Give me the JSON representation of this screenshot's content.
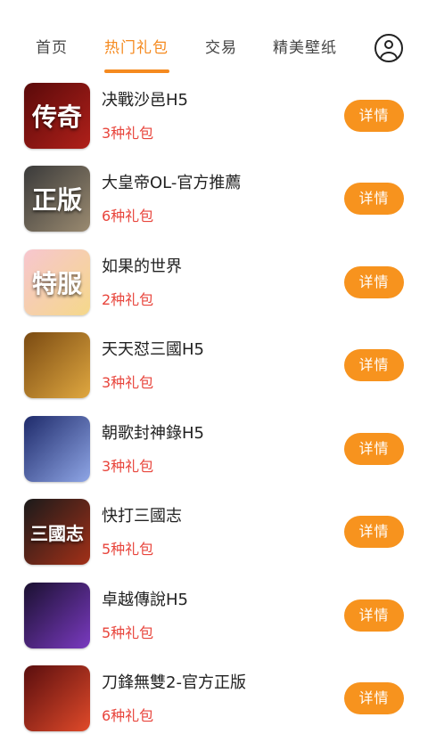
{
  "nav": {
    "tabs": [
      "首页",
      "热门礼包",
      "交易",
      "精美壁纸"
    ],
    "active_index": 1,
    "accent_color": "#f58a1f",
    "profile_icon": "user-circle-icon"
  },
  "games": [
    {
      "name": "决戰沙邑H5",
      "gift_count": "3种礼包",
      "button": "详情",
      "icon_text": "传奇",
      "icon_colors": [
        "#5a0a0a",
        "#b0201a"
      ]
    },
    {
      "name": "大皇帝OL-官方推薦",
      "gift_count": "6种礼包",
      "button": "详情",
      "icon_text": "正版",
      "icon_colors": [
        "#3a3a3a",
        "#9a8a70"
      ]
    },
    {
      "name": "如果的世界",
      "gift_count": "2种礼包",
      "button": "详情",
      "icon_text": "特服",
      "icon_colors": [
        "#f7c6cf",
        "#f5d88a"
      ]
    },
    {
      "name": "天天怼三國H5",
      "gift_count": "3种礼包",
      "button": "详情",
      "icon_text": "",
      "icon_colors": [
        "#7a4a12",
        "#e0a840"
      ]
    },
    {
      "name": "朝歌封神錄H5",
      "gift_count": "3种礼包",
      "button": "详情",
      "icon_text": "",
      "icon_colors": [
        "#1e2a6a",
        "#8fa6e6"
      ]
    },
    {
      "name": "快打三國志",
      "gift_count": "5种礼包",
      "button": "详情",
      "icon_text": "三國志",
      "icon_colors": [
        "#1a1a1a",
        "#a33018"
      ]
    },
    {
      "name": "卓越傳說H5",
      "gift_count": "5种礼包",
      "button": "详情",
      "icon_text": "",
      "icon_colors": [
        "#1a1030",
        "#7a3ac0"
      ]
    },
    {
      "name": "刀鋒無雙2-官方正版",
      "gift_count": "6种礼包",
      "button": "详情",
      "icon_text": "",
      "icon_colors": [
        "#5a0e0e",
        "#e04a2a"
      ]
    }
  ]
}
